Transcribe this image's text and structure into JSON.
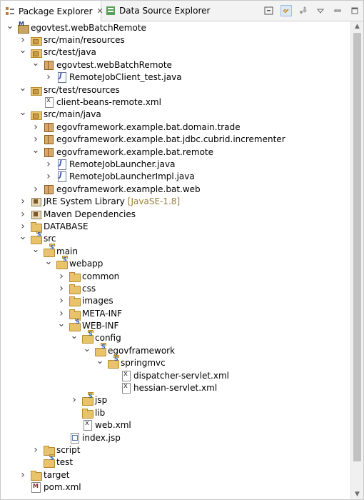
{
  "tabs": [
    {
      "label": "Package Explorer",
      "icon": "package-explorer-icon",
      "active": true,
      "close": "✕"
    },
    {
      "label": "Data Source Explorer",
      "icon": "data-source-icon",
      "active": false
    }
  ],
  "toolbar": {
    "buttons": [
      "collapse-all-icon",
      "link-with-editor-icon",
      "filters-icon",
      "view-menu-icon",
      "minimize-icon",
      "maximize-icon"
    ]
  },
  "tree": [
    {
      "depth": 0,
      "arrow": "open",
      "icon": "project",
      "label": "egovtest.webBatchRemote"
    },
    {
      "depth": 1,
      "arrow": "closed",
      "icon": "srcfolder",
      "label": "src/main/resources"
    },
    {
      "depth": 1,
      "arrow": "open",
      "icon": "srcfolder",
      "label": "src/test/java"
    },
    {
      "depth": 2,
      "arrow": "open",
      "icon": "pkg",
      "label": "egovtest.webBatchRemote"
    },
    {
      "depth": 3,
      "arrow": "closed",
      "icon": "java",
      "label": "RemoteJobClient_test.java"
    },
    {
      "depth": 1,
      "arrow": "open",
      "icon": "srcfolder",
      "label": "src/test/resources"
    },
    {
      "depth": 2,
      "arrow": "none",
      "icon": "xml",
      "label": "client-beans-remote.xml"
    },
    {
      "depth": 1,
      "arrow": "open",
      "icon": "srcfolder",
      "label": "src/main/java"
    },
    {
      "depth": 2,
      "arrow": "closed",
      "icon": "pkg",
      "label": "egovframework.example.bat.domain.trade"
    },
    {
      "depth": 2,
      "arrow": "closed",
      "icon": "pkg",
      "label": "egovframework.example.bat.jdbc.cubrid.incrementer"
    },
    {
      "depth": 2,
      "arrow": "open",
      "icon": "pkg",
      "label": "egovframework.example.bat.remote"
    },
    {
      "depth": 3,
      "arrow": "closed",
      "icon": "java",
      "label": "RemoteJobLauncher.java"
    },
    {
      "depth": 3,
      "arrow": "closed",
      "icon": "java",
      "label": "RemoteJobLauncherImpl.java"
    },
    {
      "depth": 2,
      "arrow": "closed",
      "icon": "pkg",
      "label": "egovframework.example.bat.web"
    },
    {
      "depth": 1,
      "arrow": "closed",
      "icon": "lib",
      "label": "JRE System Library",
      "decoration": "[JavaSE-1.8]"
    },
    {
      "depth": 1,
      "arrow": "closed",
      "icon": "lib",
      "label": "Maven Dependencies"
    },
    {
      "depth": 1,
      "arrow": "closed",
      "icon": "folder",
      "label": "DATABASE"
    },
    {
      "depth": 1,
      "arrow": "open",
      "icon": "spring",
      "label": "src"
    },
    {
      "depth": 2,
      "arrow": "open",
      "icon": "spring",
      "label": "main"
    },
    {
      "depth": 3,
      "arrow": "open",
      "icon": "spring",
      "label": "webapp"
    },
    {
      "depth": 4,
      "arrow": "closed",
      "icon": "folder",
      "label": "common"
    },
    {
      "depth": 4,
      "arrow": "closed",
      "icon": "folder",
      "label": "css"
    },
    {
      "depth": 4,
      "arrow": "closed",
      "icon": "folder",
      "label": "images"
    },
    {
      "depth": 4,
      "arrow": "closed",
      "icon": "folder",
      "label": "META-INF"
    },
    {
      "depth": 4,
      "arrow": "open",
      "icon": "spring",
      "label": "WEB-INF"
    },
    {
      "depth": 5,
      "arrow": "open",
      "icon": "spring",
      "label": "config"
    },
    {
      "depth": 6,
      "arrow": "open",
      "icon": "spring",
      "label": "egovframework"
    },
    {
      "depth": 7,
      "arrow": "open",
      "icon": "spring",
      "label": "springmvc"
    },
    {
      "depth": 8,
      "arrow": "none",
      "icon": "xml",
      "label": "dispatcher-servlet.xml"
    },
    {
      "depth": 8,
      "arrow": "none",
      "icon": "xml",
      "label": "hessian-servlet.xml"
    },
    {
      "depth": 5,
      "arrow": "closed",
      "icon": "spring",
      "label": "jsp"
    },
    {
      "depth": 5,
      "arrow": "none",
      "icon": "folder",
      "label": "lib"
    },
    {
      "depth": 5,
      "arrow": "none",
      "icon": "xml",
      "label": "web.xml"
    },
    {
      "depth": 4,
      "arrow": "none",
      "icon": "jsp",
      "label": "index.jsp"
    },
    {
      "depth": 2,
      "arrow": "closed",
      "icon": "folder",
      "label": "script"
    },
    {
      "depth": 2,
      "arrow": "none",
      "icon": "spring",
      "label": "test"
    },
    {
      "depth": 1,
      "arrow": "closed",
      "icon": "folder",
      "label": "target"
    },
    {
      "depth": 1,
      "arrow": "none",
      "icon": "pom",
      "label": "pom.xml"
    }
  ]
}
